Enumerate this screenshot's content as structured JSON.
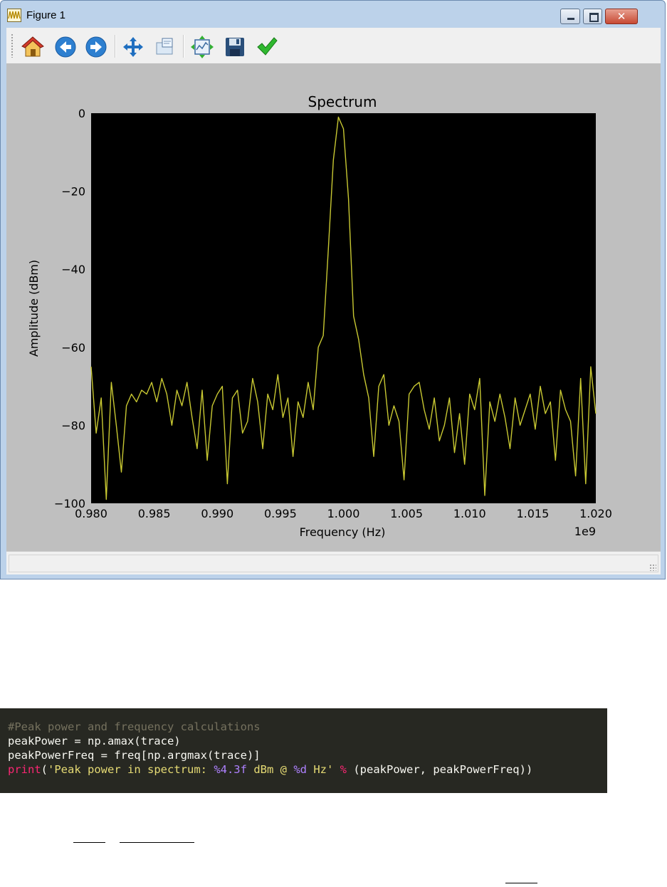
{
  "window": {
    "title": "Figure 1",
    "buttons": {
      "minimize": "minimize",
      "maximize": "maximize",
      "close": "✕"
    }
  },
  "toolbar": {
    "items": [
      {
        "name": "home",
        "icon": "home-icon"
      },
      {
        "name": "back",
        "icon": "back-arrow-icon"
      },
      {
        "name": "forward",
        "icon": "forward-arrow-icon"
      },
      {
        "name": "pan",
        "icon": "move-icon"
      },
      {
        "name": "zoom",
        "icon": "zoom-rect-icon"
      },
      {
        "name": "subplots",
        "icon": "configure-subplots-icon"
      },
      {
        "name": "save",
        "icon": "floppy-disk-icon"
      },
      {
        "name": "edit",
        "icon": "checkmark-icon"
      }
    ]
  },
  "chart_data": {
    "type": "line",
    "title": "Spectrum",
    "xlabel": "Frequency (Hz)",
    "ylabel": "Amplitude (dBm)",
    "x_offset_label": "1e9",
    "xlim": [
      0.98,
      1.02
    ],
    "ylim": [
      -100,
      0
    ],
    "x_ticks": [
      "0.980",
      "0.985",
      "0.990",
      "0.995",
      "1.000",
      "1.005",
      "1.010",
      "1.015",
      "1.020"
    ],
    "y_ticks": [
      "0",
      "−20",
      "−40",
      "−60",
      "−80",
      "−100"
    ],
    "background": "#000000",
    "line_color": "#c8c832",
    "grid": false,
    "series": [
      {
        "x": [
          0.98,
          0.9804,
          0.9808,
          0.9812,
          0.9816,
          0.982,
          0.9824,
          0.9828,
          0.9832,
          0.9836,
          0.984,
          0.9844,
          0.9848,
          0.9852,
          0.9856,
          0.986,
          0.9864,
          0.9868,
          0.9872,
          0.9876,
          0.988,
          0.9884,
          0.9888,
          0.9892,
          0.9896,
          0.99,
          0.9904,
          0.9908,
          0.9912,
          0.9916,
          0.992,
          0.9924,
          0.9928,
          0.9932,
          0.9936,
          0.994,
          0.9944,
          0.9948,
          0.9952,
          0.9956,
          0.996,
          0.9964,
          0.9968,
          0.9972,
          0.9976,
          0.998,
          0.9984,
          0.9988,
          0.9992,
          0.9996,
          1.0,
          1.0004,
          1.0008,
          1.0012,
          1.0016,
          1.002,
          1.0024,
          1.0028,
          1.0032,
          1.0036,
          1.004,
          1.0044,
          1.0048,
          1.0052,
          1.0056,
          1.006,
          1.0064,
          1.0068,
          1.0072,
          1.0076,
          1.008,
          1.0084,
          1.0088,
          1.0092,
          1.0096,
          1.01,
          1.0104,
          1.0108,
          1.0112,
          1.0116,
          1.012,
          1.0124,
          1.0128,
          1.0132,
          1.0136,
          1.014,
          1.0144,
          1.0148,
          1.0152,
          1.0156,
          1.016,
          1.0164,
          1.0168,
          1.0172,
          1.0176,
          1.018,
          1.0184,
          1.0188,
          1.0192,
          1.0196,
          1.02
        ],
        "y": [
          -65,
          -82,
          -73,
          -99,
          -69,
          -80,
          -92,
          -75,
          -72,
          -74,
          -71,
          -72,
          -69,
          -74,
          -68,
          -72,
          -80,
          -71,
          -75,
          -69,
          -78,
          -86,
          -71,
          -89,
          -75,
          -72,
          -70,
          -95,
          -73,
          -71,
          -82,
          -79,
          -68,
          -74,
          -86,
          -72,
          -76,
          -67,
          -78,
          -73,
          -88,
          -74,
          -78,
          -69,
          -76,
          -60,
          -57,
          -35,
          -12,
          -1,
          -4,
          -22,
          -52,
          -58,
          -67,
          -73,
          -88,
          -70,
          -67,
          -80,
          -75,
          -79,
          -94,
          -72,
          -70,
          -69,
          -76,
          -81,
          -73,
          -84,
          -80,
          -73,
          -87,
          -77,
          -90,
          -72,
          -76,
          -68,
          -98,
          -74,
          -79,
          -72,
          -78,
          -86,
          -73,
          -80,
          -76,
          -72,
          -81,
          -70,
          -77,
          -74,
          -89,
          -71,
          -76,
          -79,
          -93,
          -68,
          -95,
          -65,
          -77
        ]
      }
    ]
  },
  "code": {
    "lines": [
      {
        "comment": "#Peak power and frequency calculations"
      },
      {
        "plain": "peakPower = np.amax(trace)"
      },
      {
        "plain": "peakPowerFreq = freq[np.argmax(trace)]"
      },
      {
        "kw": "print",
        "p1": "(",
        "s1": "'Peak power in spectrum: ",
        "f1": "%4.3f",
        "s2": " dBm @ ",
        "f2": "%d",
        "s3": " Hz'",
        "sp": " ",
        "op": "%",
        "rest": " (peakPower, peakPowerFreq))"
      }
    ]
  }
}
